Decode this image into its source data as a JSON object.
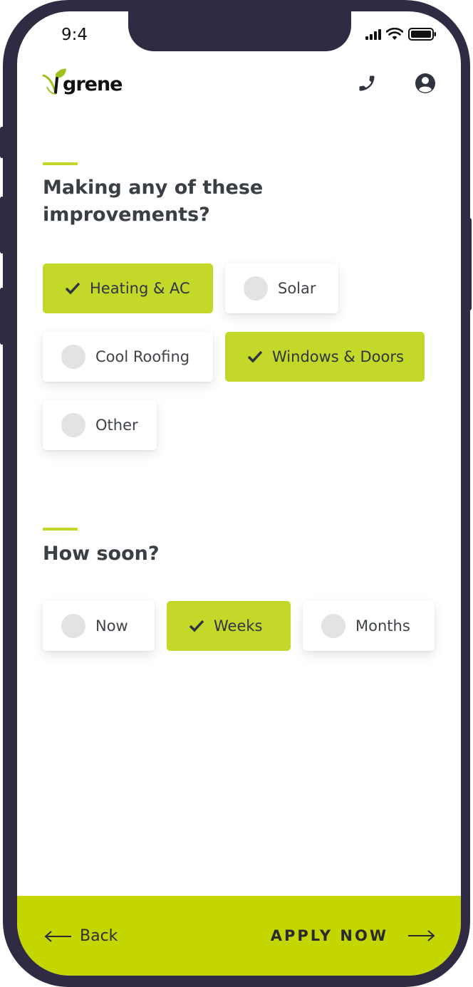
{
  "status_bar": {
    "time": "9:4"
  },
  "brand": {
    "logo_text": "grene",
    "accent_color": "#c3d829"
  },
  "header": {
    "phone_icon": "phone-icon",
    "account_icon": "account-icon"
  },
  "improvements": {
    "question_line1": "Making any of these",
    "question_line2": "improvements?",
    "options": [
      {
        "label": "Heating & AC",
        "selected": true
      },
      {
        "label": "Solar",
        "selected": false
      },
      {
        "label": "Cool Roofing",
        "selected": false
      },
      {
        "label": "Windows & Doors",
        "selected": true
      },
      {
        "label": "Other",
        "selected": false
      }
    ]
  },
  "timing": {
    "question": "How soon?",
    "options": [
      {
        "label": "Now",
        "selected": false
      },
      {
        "label": "Weeks",
        "selected": true
      },
      {
        "label": "Months",
        "selected": false
      }
    ]
  },
  "footer": {
    "back_label": "Back",
    "apply_label": "APPLY NOW",
    "bar_color": "#c3d600"
  }
}
